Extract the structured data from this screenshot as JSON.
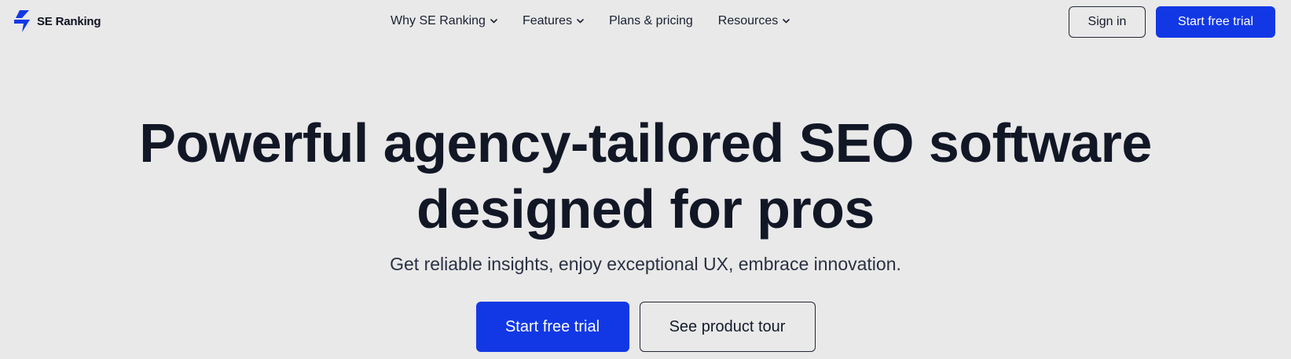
{
  "brand": {
    "name": "SE Ranking",
    "logo_icon": "bolt-logo-icon",
    "logo_color": "#1238e5"
  },
  "nav": {
    "items": [
      {
        "label": "Why SE Ranking",
        "has_dropdown": true
      },
      {
        "label": "Features",
        "has_dropdown": true
      },
      {
        "label": "Plans & pricing",
        "has_dropdown": false
      },
      {
        "label": "Resources",
        "has_dropdown": true
      }
    ]
  },
  "header_actions": {
    "sign_in_label": "Sign in",
    "trial_label": "Start free trial"
  },
  "hero": {
    "title_line1": "Powerful agency-tailored SEO software",
    "title_line2": "designed for pros",
    "subtitle": "Get reliable insights, enjoy exceptional UX, embrace innovation.",
    "primary_cta": "Start free trial",
    "secondary_cta": "See product tour"
  },
  "colors": {
    "background": "#e9e9e9",
    "accent": "#1238e5",
    "text": "#141a2b"
  }
}
